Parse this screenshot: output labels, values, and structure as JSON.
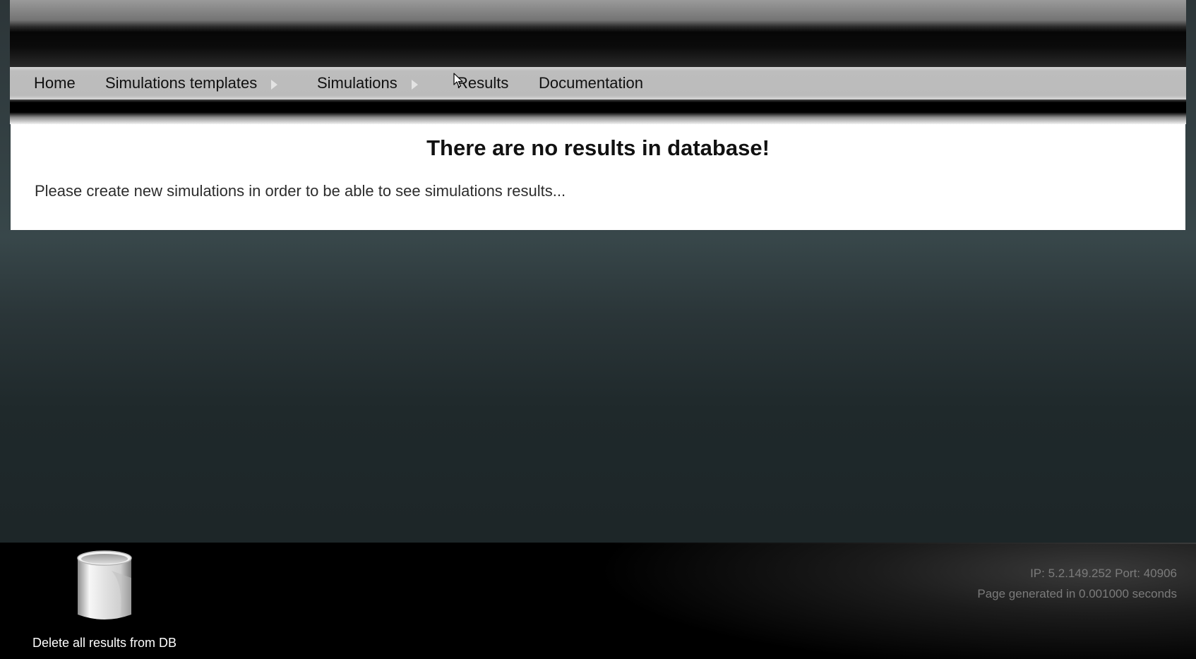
{
  "menu": {
    "items": [
      {
        "label": "Home",
        "has_submenu": false
      },
      {
        "label": "Simulations templates",
        "has_submenu": true
      },
      {
        "label": "Simulations",
        "has_submenu": true
      },
      {
        "label": "Results",
        "has_submenu": false
      },
      {
        "label": "Documentation",
        "has_submenu": false
      }
    ]
  },
  "content": {
    "heading": "There are no results in database!",
    "message": "Please create new simulations in order to be able to see simulations results..."
  },
  "footer": {
    "delete_label": "Delete all results from DB",
    "delete_icon": "trash-can-icon",
    "server_info": "IP: 5.2.149.252 Port: 40906",
    "generated_info": "Page generated in 0.001000 seconds"
  },
  "colors": {
    "menu_bar": "#bbbbbb",
    "content_bg": "#ffffff",
    "footer_bg": "#000000",
    "page_bg": "#1f292b"
  }
}
